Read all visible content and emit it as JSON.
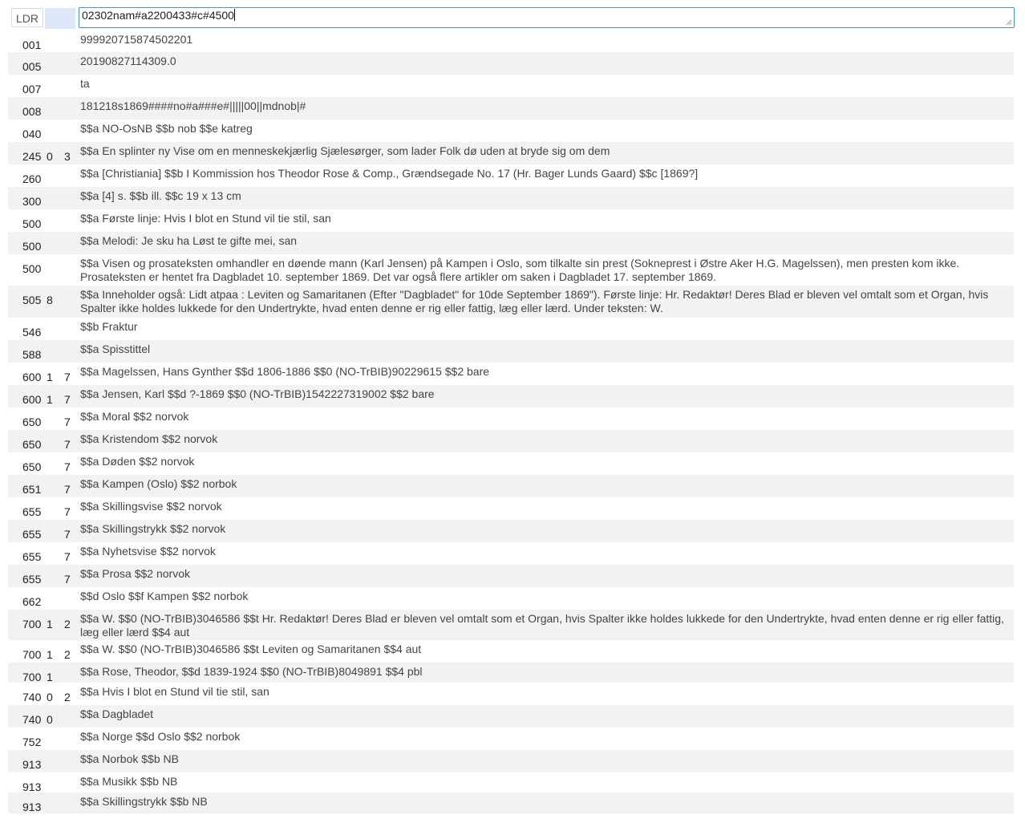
{
  "leader": {
    "label": "LDR",
    "value": "02302nam#a2200433#c#4500"
  },
  "fields": [
    {
      "tag": "001",
      "ind1": "",
      "ind2": "",
      "value": "999920715874502201"
    },
    {
      "tag": "005",
      "ind1": "",
      "ind2": "",
      "value": "20190827114309.0"
    },
    {
      "tag": "007",
      "ind1": "",
      "ind2": "",
      "value": "ta"
    },
    {
      "tag": "008",
      "ind1": "",
      "ind2": "",
      "value": "181218s1869####no#a###e#|||||00||mdnob|#"
    },
    {
      "tag": "040",
      "ind1": "",
      "ind2": "",
      "value": "$$a NO-OsNB $$b nob $$e katreg"
    },
    {
      "tag": "245",
      "ind1": "0",
      "ind2": "3",
      "value": "$$a En splinter ny Vise om en menneskekjærlig Sjælesørger, som lader Folk dø uden at bryde sig om dem"
    },
    {
      "tag": "260",
      "ind1": "",
      "ind2": "",
      "value": "$$a [Christiania] $$b I Kommission hos Theodor Rose & Comp., Grændsegade No. 17 (Hr. Bager Lunds Gaard) $$c [1869?]"
    },
    {
      "tag": "300",
      "ind1": "",
      "ind2": "",
      "value": "$$a [4] s. $$b ill. $$c 19 x 13 cm"
    },
    {
      "tag": "500",
      "ind1": "",
      "ind2": "",
      "value": "$$a Første linje: Hvis I blot en Stund vil tie stil, san"
    },
    {
      "tag": "500",
      "ind1": "",
      "ind2": "",
      "value": "$$a Melodi: Je sku ha Løst te gifte mei, san"
    },
    {
      "tag": "500",
      "ind1": "",
      "ind2": "",
      "value": "$$a Visen og prosateksten omhandler en døende mann (Karl Jensen) på Kampen i Oslo, som tilkalte sin prest (Sokneprest i Østre Aker H.G. Magelssen), men presten kom ikke. Prosateksten er hentet fra Dagbladet 10. september 1869. Det var også flere artikler om saken i Dagbladet 17. september 1869."
    },
    {
      "tag": "505",
      "ind1": "8",
      "ind2": "",
      "value": "$$a Inneholder også: Lidt atpaa : Leviten og Samaritanen (Efter \"Dagbladet\" for 10de September 1869\"). Første linje: Hr. Redaktør! Deres Blad er bleven vel omtalt som et Organ, hvis Spalter ikke holdes lukkede for den Undertrykte, hvad enten denne er rig eller fattig, læg eller lærd. Under teksten: W."
    },
    {
      "tag": "546",
      "ind1": "",
      "ind2": "",
      "value": "$$b Fraktur"
    },
    {
      "tag": "588",
      "ind1": "",
      "ind2": "",
      "value": "$$a Spisstittel"
    },
    {
      "tag": "600",
      "ind1": "1",
      "ind2": "7",
      "value": "$$a Magelssen, Hans Gynther $$d 1806-1886 $$0 (NO-TrBIB)90229615 $$2 bare"
    },
    {
      "tag": "600",
      "ind1": "1",
      "ind2": "7",
      "value": "$$a Jensen, Karl $$d ?-1869 $$0 (NO-TrBIB)1542227319002 $$2 bare"
    },
    {
      "tag": "650",
      "ind1": "",
      "ind2": "7",
      "value": "$$a Moral $$2 norvok"
    },
    {
      "tag": "650",
      "ind1": "",
      "ind2": "7",
      "value": "$$a Kristendom $$2 norvok"
    },
    {
      "tag": "650",
      "ind1": "",
      "ind2": "7",
      "value": "$$a Døden $$2 norvok"
    },
    {
      "tag": "651",
      "ind1": "",
      "ind2": "7",
      "value": "$$a Kampen (Oslo) $$2 norbok"
    },
    {
      "tag": "655",
      "ind1": "",
      "ind2": "7",
      "value": "$$a Skillingsvise $$2 norvok"
    },
    {
      "tag": "655",
      "ind1": "",
      "ind2": "7",
      "value": "$$a Skillingstrykk $$2 norvok"
    },
    {
      "tag": "655",
      "ind1": "",
      "ind2": "7",
      "value": "$$a Nyhetsvise $$2 norvok"
    },
    {
      "tag": "655",
      "ind1": "",
      "ind2": "7",
      "value": "$$a Prosa $$2 norvok"
    },
    {
      "tag": "662",
      "ind1": "",
      "ind2": "",
      "value": "$$d Oslo $$f Kampen $$2 norbok"
    },
    {
      "tag": "700",
      "ind1": "1",
      "ind2": "2",
      "value": "$$a W. $$0 (NO-TrBIB)3046586 $$t Hr. Redaktør! Deres Blad er bleven vel omtalt som et Organ, hvis Spalter ikke holdes lukkede for den Undertrykte, hvad enten denne er rig eller fattig, læg eller lærd $$4 aut"
    },
    {
      "tag": "700",
      "ind1": "1",
      "ind2": "2",
      "value": "$$a W. $$0 (NO-TrBIB)3046586 $$t Leviten og Samaritanen $$4 aut"
    },
    {
      "tag": "700",
      "ind1": "1",
      "ind2": "",
      "value": "$$a Rose, Theodor, $$d 1839-1924 $$0 (NO-TrBIB)8049891 $$4 pbl"
    },
    {
      "tag": "740",
      "ind1": "0",
      "ind2": "2",
      "value": "$$a Hvis I blot en Stund vil tie stil, san"
    },
    {
      "tag": "740",
      "ind1": "0",
      "ind2": "",
      "value": "$$a Dagbladet"
    },
    {
      "tag": "752",
      "ind1": "",
      "ind2": "",
      "value": "$$a Norge $$d Oslo $$2 norbok"
    },
    {
      "tag": "913",
      "ind1": "",
      "ind2": "",
      "value": "$$a Norbok $$b NB"
    },
    {
      "tag": "913",
      "ind1": "",
      "ind2": "",
      "value": "$$a Musikk $$b NB"
    },
    {
      "tag": "913",
      "ind1": "",
      "ind2": "",
      "value": "$$a Skillingstrykk $$b NB"
    }
  ]
}
